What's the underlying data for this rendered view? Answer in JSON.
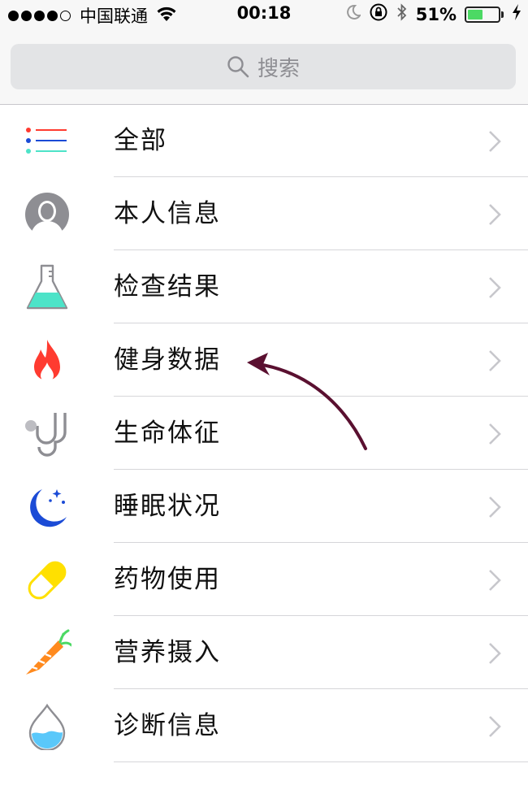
{
  "status_bar": {
    "carrier": "中国联通",
    "time": "00:18",
    "battery": "51%",
    "battery_level": 0.51
  },
  "search": {
    "placeholder": "搜索"
  },
  "categories": [
    {
      "label": "全部",
      "icon": "list-icon"
    },
    {
      "label": "本人信息",
      "icon": "person-icon"
    },
    {
      "label": "检查结果",
      "icon": "flask-icon"
    },
    {
      "label": "健身数据",
      "icon": "flame-icon"
    },
    {
      "label": "生命体征",
      "icon": "stethoscope-icon"
    },
    {
      "label": "睡眠状况",
      "icon": "moon-icon"
    },
    {
      "label": "药物使用",
      "icon": "pill-icon"
    },
    {
      "label": "营养摄入",
      "icon": "carrot-icon"
    },
    {
      "label": "诊断信息",
      "icon": "drop-icon"
    }
  ],
  "colors": {
    "red": "#ff3b30",
    "teal": "#4de3c8",
    "blue": "#1b4bd6",
    "yellow": "#ffe000",
    "orange": "#ff8a1e",
    "gray_icon": "#8e8e93",
    "arrow": "#5a1030"
  }
}
